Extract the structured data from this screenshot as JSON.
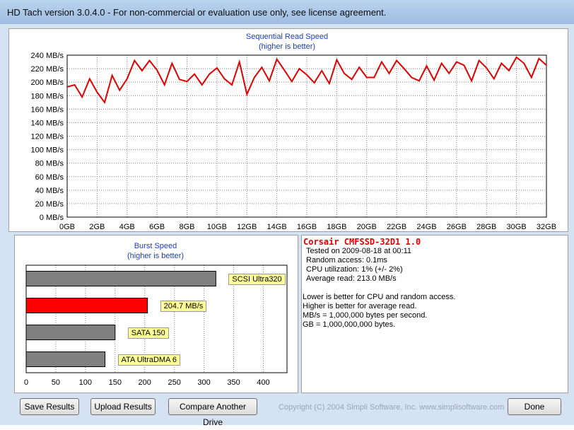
{
  "window": {
    "title": "HD Tach version 3.0.4.0  - For non-commercial or evaluation use only, see license agreement."
  },
  "read_chart": {
    "title": "Sequential Read Speed",
    "subtitle": "(higher is better)"
  },
  "burst_chart": {
    "title": "Burst Speed",
    "subtitle": "(higher is better)"
  },
  "chart_data": [
    {
      "type": "line",
      "title": "Sequential Read Speed",
      "subtitle": "(higher is better)",
      "xlabel": "",
      "ylabel": "",
      "x_ticks": [
        "0GB",
        "2GB",
        "4GB",
        "6GB",
        "8GB",
        "10GB",
        "12GB",
        "14GB",
        "16GB",
        "18GB",
        "20GB",
        "22GB",
        "24GB",
        "26GB",
        "28GB",
        "30GB",
        "32GB"
      ],
      "y_ticks": [
        "0 MB/s",
        "20 MB/s",
        "40 MB/s",
        "60 MB/s",
        "80 MB/s",
        "100 MB/s",
        "120 MB/s",
        "140 MB/s",
        "160 MB/s",
        "180 MB/s",
        "200 MB/s",
        "220 MB/s",
        "240 MB/s"
      ],
      "xlim": [
        0,
        32
      ],
      "ylim": [
        0,
        240
      ],
      "grid": true,
      "color": "#e00000",
      "series": [
        {
          "x": [
            0,
            0.5,
            1,
            1.5,
            2,
            2.5,
            3,
            3.5,
            4,
            4.5,
            5,
            5.5,
            6,
            6.5,
            7,
            7.5,
            8,
            8.5,
            9,
            9.5,
            10,
            10.5,
            11,
            11.5,
            12,
            12.5,
            13,
            13.5,
            14,
            14.5,
            15,
            15.5,
            16,
            16.5,
            17,
            17.5,
            18,
            18.5,
            19,
            19.5,
            20,
            20.5,
            21,
            21.5,
            22,
            22.5,
            23,
            23.5,
            24,
            24.5,
            25,
            25.5,
            26,
            26.5,
            27,
            27.5,
            28,
            28.5,
            29,
            29.5,
            30,
            30.5,
            31,
            31.5,
            32
          ],
          "y": [
            193,
            196,
            178,
            205,
            185,
            170,
            210,
            188,
            205,
            232,
            217,
            232,
            218,
            196,
            228,
            204,
            201,
            212,
            196,
            212,
            221,
            205,
            196,
            230,
            182,
            207,
            222,
            202,
            234,
            218,
            201,
            220,
            211,
            199,
            217,
            198,
            233,
            213,
            204,
            222,
            207,
            207,
            230,
            213,
            232,
            220,
            207,
            202,
            224,
            203,
            228,
            213,
            230,
            225,
            202,
            232,
            221,
            205,
            228,
            217,
            237,
            228,
            207,
            235,
            225
          ]
        }
      ]
    },
    {
      "type": "bar",
      "title": "Burst Speed",
      "subtitle": "(higher is better)",
      "orientation": "horizontal",
      "xlim": [
        0,
        440
      ],
      "x_ticks": [
        "0",
        "50",
        "100",
        "150",
        "200",
        "250",
        "300",
        "350",
        "400"
      ],
      "grid": true,
      "categories": [
        "SCSI Ultra320",
        "204.7 MB/s",
        "SATA 150",
        "ATA UltraDMA 6"
      ],
      "values": [
        320,
        204.7,
        150,
        133
      ],
      "colors": [
        "#808080",
        "#ff0000",
        "#808080",
        "#808080"
      ]
    }
  ],
  "results": {
    "drive": "Corsair CMFSSD-32D1 1.0",
    "tested": "Tested on 2009-08-18 at 00:11",
    "random_access": "Random access: 0.1ms",
    "cpu": "CPU utilization: 1% (+/- 2%)",
    "average_read": "Average read: 213.0 MB/s",
    "note1": "Lower is better for CPU and random access.",
    "note2": "Higher is better for average read.",
    "note3": "MB/s = 1,000,000 bytes per second.",
    "note4": "GB = 1,000,000,000 bytes."
  },
  "buttons": {
    "save": "Save Results",
    "upload": "Upload Results",
    "compare": "Compare Another Drive",
    "done": "Done"
  },
  "footer": {
    "copyright": "Copyright (C) 2004 Simpli Software, Inc. www.simplisoftware.com"
  }
}
